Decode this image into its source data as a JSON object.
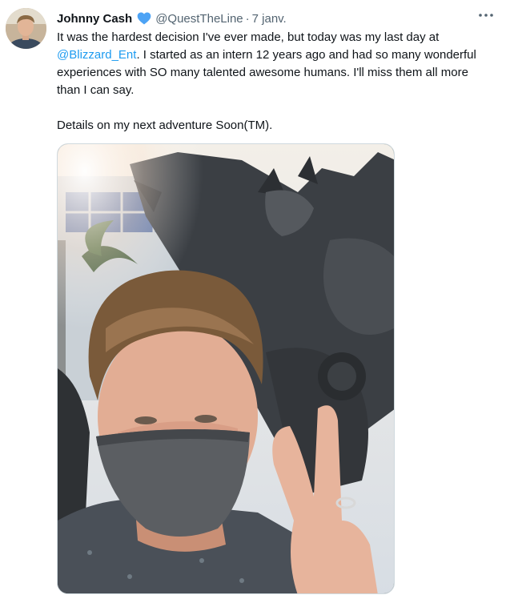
{
  "tweet": {
    "author_name": "Johnny Cash",
    "author_handle": "@QuestTheLine",
    "separator": "·",
    "date": "7 janv.",
    "more_icon": "more-horizontal-icon",
    "badge_icon": "heart-icon",
    "badge_color": "#4da3f5",
    "text_line1_before": "It was the hardest decision I've ever made, but today was my last day at",
    "mention": "@Blizzard_Ent",
    "text_line1_after": ". I started as an intern 12 years ago and had so many wonderful experiences with SO many talented awesome humans. I'll miss them all more than I can say.",
    "text_line2": "Details on my next adventure Soon(TM)."
  },
  "colors": {
    "text": "#0f1419",
    "secondary": "#536471",
    "link": "#1d9bf0"
  }
}
